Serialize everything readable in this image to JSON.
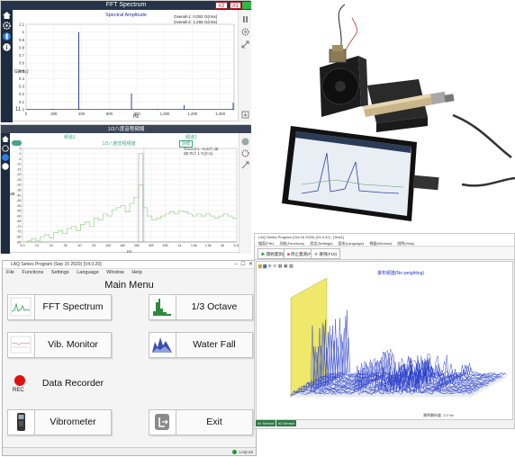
{
  "fft": {
    "title": "FFT Spectrum",
    "badges": [
      "#2",
      "#1"
    ],
    "plot_title": "Spectral Amplitude",
    "legend": [
      "Overall-1: 0.002 G(rms)",
      "Overall-2: 1.255 G(rms)"
    ],
    "ylabel": "G(rms)",
    "xlabel": "Hz",
    "yticks": [
      "1.1",
      "1",
      "0.9",
      "0.8",
      "0.7",
      "0.6",
      "0.5",
      "0.4",
      "0.3",
      "0.2",
      "0.1",
      "0"
    ],
    "xticks": [
      "0",
      "200",
      "400",
      "600",
      "800",
      "1,000",
      "1,200",
      "1,400"
    ],
    "counter": "11",
    "line_color": "#1f2f9c"
  },
  "octave": {
    "title": "1/3八度音程頻譜",
    "subtitle": "1/3八度音程頻譜",
    "tab_left": "頻道1",
    "tab_right": "頻道2",
    "cursor_tag": "游標",
    "readout": [
      "Overall-1: -9.207 dB",
      "dB Ref: 1 G(rms)"
    ],
    "ylabel": "dB",
    "xlabel": "Hz",
    "yticks": [
      "5",
      "0",
      "-5",
      "-10",
      "-15",
      "-20",
      "-25",
      "-30",
      "-35",
      "-40",
      "-45",
      "-50",
      "-55",
      "-60",
      "-65",
      "-70",
      "-75",
      "-80",
      "-85"
    ],
    "xticks": [
      "6.3",
      "10",
      "16",
      "25",
      "40",
      "63",
      "100",
      "160",
      "250",
      "400",
      "630",
      "1k",
      "1.6k",
      "2.5k",
      "4k",
      "6.3k"
    ],
    "ch1_color": "#9ccf8e",
    "ch2_color": "#777777",
    "accent": "#43a38b"
  },
  "menu": {
    "window_title": "LAQ Series Program (Sep 15 2020) [V4.0.20]",
    "menubar": [
      "File",
      "Functions",
      "Settings",
      "Language",
      "Window",
      "Help"
    ],
    "title": "Main Menu",
    "buttons": [
      {
        "label": "FFT Spectrum",
        "icon": "fft-spectrum-icon"
      },
      {
        "label": "1/3 Octave",
        "icon": "octave-icon"
      },
      {
        "label": "Vib. Monitor",
        "icon": "vib-monitor-icon"
      },
      {
        "label": "Water Fall",
        "icon": "waterfall-icon"
      },
      {
        "label": "Data Recorder",
        "icon": "rec-icon",
        "icon_text": "REC"
      },
      {
        "label": "Exit",
        "icon": "exit-icon"
      },
      {
        "label": "Vibrometer",
        "icon": "vibrometer-icon"
      }
    ],
    "status": "LAQ-22",
    "status_color": "#1f9a3a"
  },
  "waterfall": {
    "window_title": "LAQ Series Program (Oct 16 2020) [V4.0.22] - [Test1]",
    "menubar": [
      "檔案(File)",
      "功能(Functions)",
      "設定(Settings)",
      "語系(Language)",
      "視窗(Window)",
      "說明(Help)"
    ],
    "toolbar_buttons": [
      "開始量測(F5)",
      "停止量測(F7)",
      "選項(F10)"
    ],
    "plot_title": "瀑布頻譜(No weighting)",
    "channel_tabs": [
      "#1 Sensor",
      "#2 Sensor"
    ],
    "footer_caption": "頻率解析度: 1.0 Hz",
    "wall_color": "#efe86a",
    "trace_color": "#2a40c8"
  }
}
